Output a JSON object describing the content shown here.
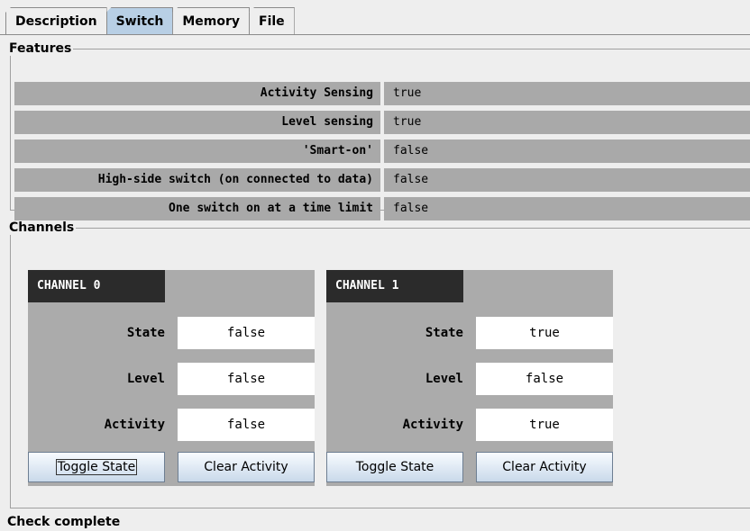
{
  "tabs": [
    {
      "label": "Description"
    },
    {
      "label": "Switch"
    },
    {
      "label": "Memory"
    },
    {
      "label": "File"
    }
  ],
  "features": {
    "legend": "Features",
    "rows": [
      {
        "key": "Activity Sensing",
        "value": "true"
      },
      {
        "key": "Level sensing",
        "value": "true"
      },
      {
        "key": "'Smart-on'",
        "value": "false"
      },
      {
        "key": "High-side switch (on connected to data)",
        "value": "false"
      },
      {
        "key": "One switch on at a time limit",
        "value": "false"
      }
    ]
  },
  "channels": {
    "legend": "Channels",
    "items": [
      {
        "title": "CHANNEL 0",
        "state_label": "State",
        "state": "false",
        "level_label": "Level",
        "level": "false",
        "activity_label": "Activity",
        "activity": "false",
        "toggle_label": "Toggle State",
        "clear_label": "Clear Activity"
      },
      {
        "title": "CHANNEL 1",
        "state_label": "State",
        "state": "true",
        "level_label": "Level",
        "level": "false",
        "activity_label": "Activity",
        "activity": "true",
        "toggle_label": "Toggle State",
        "clear_label": "Clear Activity"
      }
    ]
  },
  "status": "Check complete"
}
